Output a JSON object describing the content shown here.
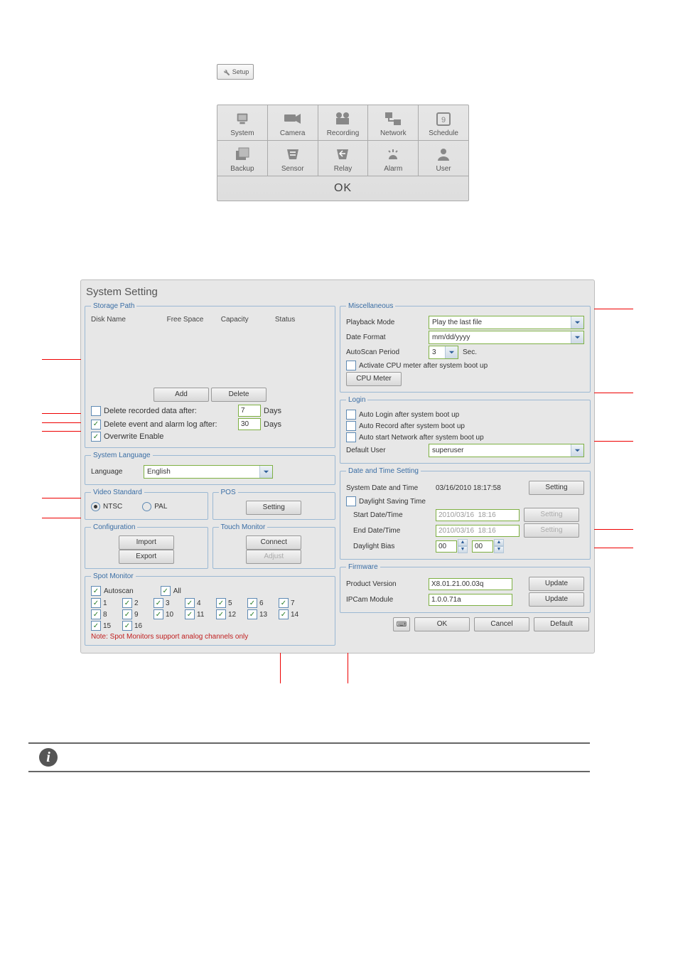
{
  "setup_button": "Setup",
  "toolbar": {
    "r1": [
      "System",
      "Camera",
      "Recording",
      "Network",
      "Schedule"
    ],
    "r2": [
      "Backup",
      "Sensor",
      "Relay",
      "Alarm",
      "User"
    ],
    "ok": "OK"
  },
  "dialog": {
    "title": "System Setting",
    "storage": {
      "legend": "Storage Path",
      "cols": [
        "Disk Name",
        "Free Space",
        "Capacity",
        "Status"
      ],
      "add": "Add",
      "delete": "Delete",
      "del_rec_chk": false,
      "del_rec_label": "Delete recorded data after:",
      "del_rec_val": "7",
      "days": "Days",
      "del_evt_chk": true,
      "del_evt_label": "Delete event and alarm log after:",
      "del_evt_val": "30",
      "ow_chk": true,
      "ow_label": "Overwrite Enable"
    },
    "lang": {
      "legend": "System Language",
      "label": "Language",
      "value": "English"
    },
    "video": {
      "legend": "Video Standard",
      "ntsc": "NTSC",
      "pal": "PAL"
    },
    "pos": {
      "legend": "POS",
      "setting": "Setting"
    },
    "config": {
      "legend": "Configuration",
      "import": "Import",
      "export": "Export"
    },
    "touch": {
      "legend": "Touch Monitor",
      "connect": "Connect",
      "adjust": "Adjust"
    },
    "spot": {
      "legend": "Spot Monitor",
      "autoscan": "Autoscan",
      "all": "All",
      "note": "Note: Spot Monitors support analog channels only",
      "items": [
        "1",
        "2",
        "3",
        "4",
        "5",
        "6",
        "7",
        "8",
        "9",
        "10",
        "11",
        "12",
        "13",
        "14",
        "15",
        "16"
      ]
    },
    "misc": {
      "legend": "Miscellaneous",
      "pb_label": "Playback Mode",
      "pb_value": "Play the last file",
      "df_label": "Date Format",
      "df_value": "mm/dd/yyyy",
      "as_label": "AutoScan Period",
      "as_value": "3",
      "as_sec": "Sec.",
      "cpu_chk": false,
      "cpu_label": "Activate CPU meter after system boot up",
      "cpu_btn": "CPU Meter"
    },
    "login": {
      "legend": "Login",
      "auto_login": "Auto Login after system boot up",
      "auto_record": "Auto Record after system boot up",
      "auto_net": "Auto start Network after system boot up",
      "def_user_label": "Default User",
      "def_user_value": "superuser"
    },
    "date": {
      "legend": "Date and Time Setting",
      "sys_label": "System Date and Time",
      "sys_value": "03/16/2010  18:17:58",
      "setting": "Setting",
      "dst_chk": false,
      "dst_label": "Daylight Saving Time",
      "start_label": "Start Date/Time",
      "start_value": "2010/03/16  18:16",
      "end_label": "End Date/Time",
      "end_value": "2010/03/16  18:16",
      "bias_label": "Daylight Bias",
      "bias_h": "00",
      "bias_m": "00"
    },
    "fw": {
      "legend": "Firmware",
      "pv_label": "Product Version",
      "pv_value": "X8.01.21.00.03q",
      "update": "Update",
      "ip_label": "IPCam Module",
      "ip_value": "1.0.0.71a"
    },
    "buttons": {
      "ok": "OK",
      "cancel": "Cancel",
      "default": "Default"
    }
  }
}
